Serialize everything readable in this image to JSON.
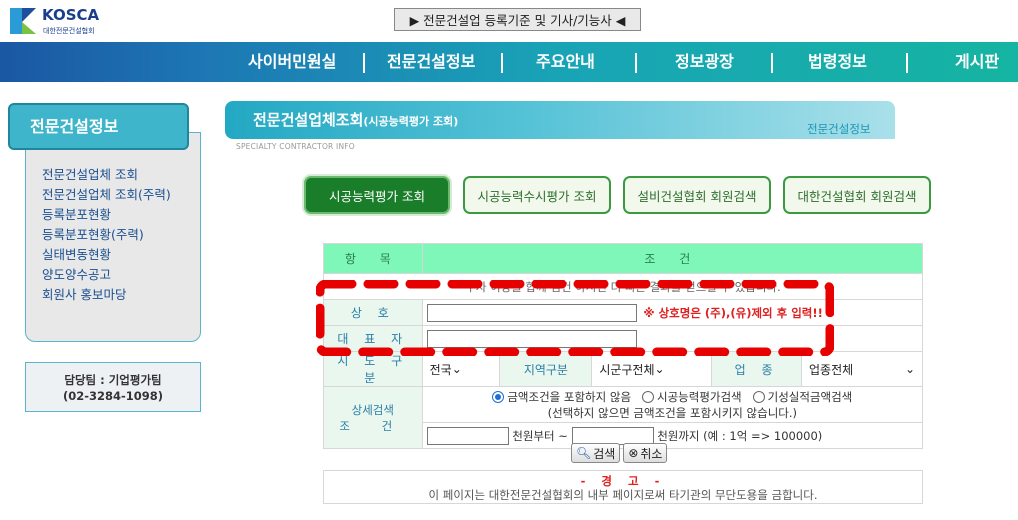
{
  "logo": {
    "name": "KOSCA",
    "sub": "대한전문건설협회"
  },
  "top_button": {
    "label": "▶ 전문건설업 등록기준 및 기사/기능사 ◀"
  },
  "nav": {
    "items": [
      "사이버민원실",
      "전문건설정보",
      "주요안내",
      "정보광장",
      "법령정보",
      "게시판"
    ]
  },
  "sidebar": {
    "title": "전문건설정보",
    "items": [
      "전문건설업체 조회",
      "전문건설업체 조회(주력)",
      "등록분포현황",
      "등록분포현황(주력)",
      "실태변동현황",
      "양도양수공고",
      "회원사 홍보마당"
    ],
    "contact_team": "담당팀 : 기업평가팀",
    "contact_phone": "(02-3284-1098)"
  },
  "header": {
    "title": "전문건설업체조회",
    "title_suffix": "(시공능력평가 조회)",
    "subtitle": "전문건설정보",
    "english": "SPECIALTY CONTRACTOR INFO"
  },
  "tabs": [
    "시공능력평가 조회",
    "시공능력수시평가 조회",
    "설비건설협회 회원검색",
    "대한건설협회 회원검색"
  ],
  "form": {
    "col_item": "항 목",
    "col_cond": "조 건",
    "info_text": "두자 이상을 합께 검건 하시면 더 빠른 결과를 얻으실 수 있습니다.",
    "company_label": "상 호",
    "company_value": "",
    "company_warning": "※ 상호명은 (주),(유)제외 후 입력!!",
    "ceo_label": "대 표 자",
    "ceo_value": "",
    "region_label": "시 도 구 분",
    "region_value": "전국",
    "area_label": "지역구분",
    "area_value": "시군구전체",
    "industry_label": "업 종",
    "industry_value": "업종전체",
    "detail_label_1": "상세검색",
    "detail_label_2": "조 건",
    "radio_options": [
      "금액조건을 포함하지 않음",
      "시공능력평가검색",
      "기성실적금액검색"
    ],
    "radio_selected": 0,
    "radio_note": "(선택하지 않으면 금액조건을 포함시키지 않습니다.)",
    "amount_from_value": "",
    "amount_from_suffix": "천원부터 ~",
    "amount_to_value": "",
    "amount_to_suffix": "천원까지 (예 : 1억 => 100000)",
    "search_button": "검색",
    "cancel_button": "취소"
  },
  "notice": {
    "title": "- 경 고 -",
    "message": "이 페이지는 대한전문건설협회의 내부 페이지로써 타기관의 무단도용을 금합니다."
  },
  "colors": {
    "nav_start": "#1b57a3",
    "nav_end": "#16b4a2",
    "active_tab": "#1a7d2a",
    "warning": "#e02020",
    "annotation": "#e60000"
  }
}
